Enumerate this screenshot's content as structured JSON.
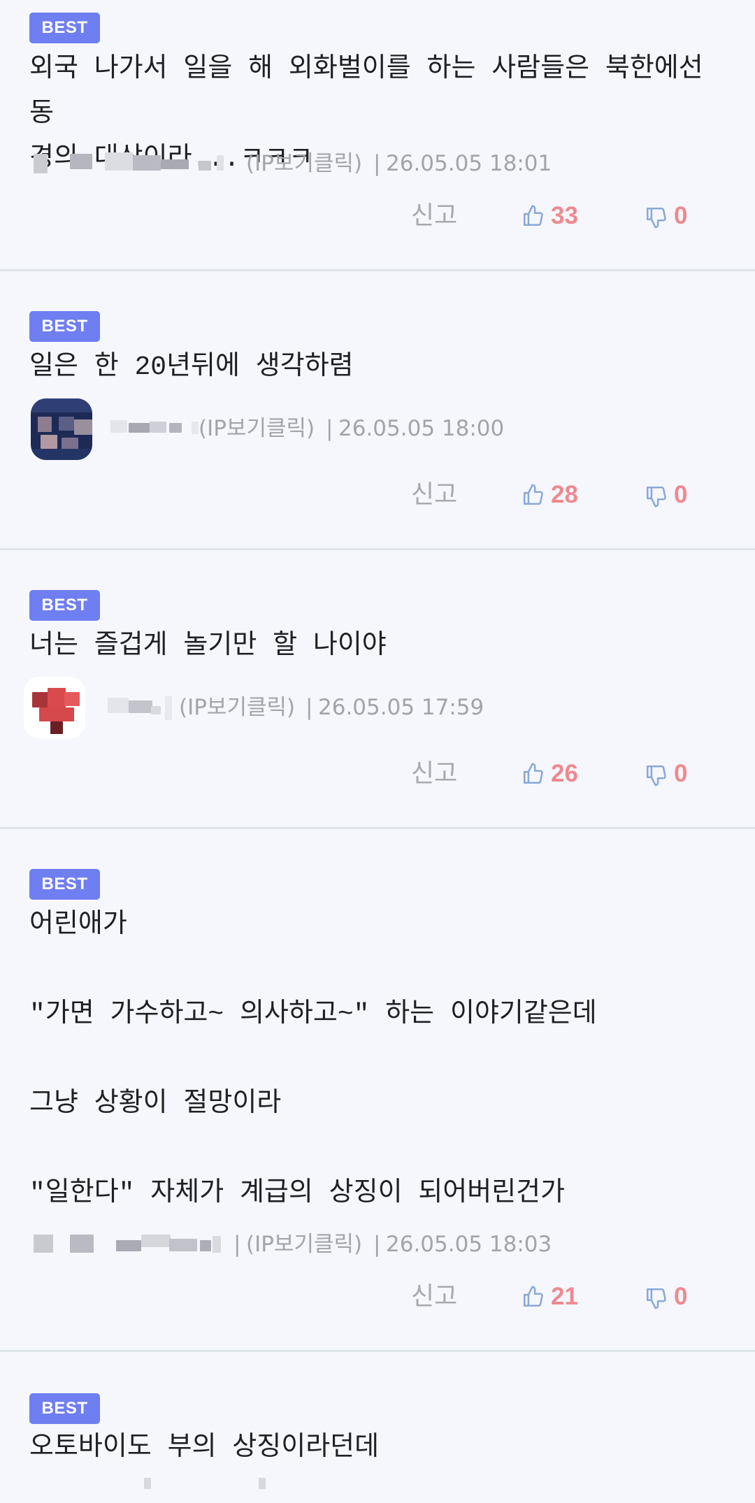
{
  "colors": {
    "background": "#f5f7fc",
    "badge": "#6f7ef0",
    "count": "#ee8a90",
    "icon": "#8aa8d8",
    "meta": "#a2a4ab"
  },
  "comments": [
    {
      "badge": "BEST",
      "text": "외국 나가서 일을 해 외화벌이를 하는 사람들은 북한에선 동\n경의 대상이라...ㅋㅋㅋ",
      "ip_label": "(IP보기클릭)",
      "separator": "|",
      "date": "26.05.05 18:01",
      "report_label": "신고",
      "likes": "33",
      "dislikes": "0",
      "like_icon": "thumbs-up-icon",
      "dislike_icon": "thumbs-down-icon"
    },
    {
      "badge": "BEST",
      "text": "일은 한 20년뒤에 생각하렴",
      "ip_label": "(IP보기클릭)",
      "separator": "|",
      "date": "26.05.05 18:00",
      "report_label": "신고",
      "likes": "28",
      "dislikes": "0",
      "like_icon": "thumbs-up-icon",
      "dislike_icon": "thumbs-down-icon"
    },
    {
      "badge": "BEST",
      "text": "너는 즐겁게 놀기만 할 나이야",
      "ip_label": "(IP보기클릭)",
      "separator": "|",
      "date": "26.05.05 17:59",
      "report_label": "신고",
      "likes": "26",
      "dislikes": "0",
      "like_icon": "thumbs-up-icon",
      "dislike_icon": "thumbs-down-icon"
    },
    {
      "badge": "BEST",
      "text": "어린애가\n\n\"가면 가수하고~ 의사하고~\" 하는 이야기같은데\n\n그냥 상황이 절망이라\n\n\"일한다\" 자체가 계급의 상징이 되어버린건가",
      "ip_label": "(IP보기클릭)",
      "separator": "|",
      "date": "26.05.05 18:03",
      "report_label": "신고",
      "likes": "21",
      "dislikes": "0",
      "like_icon": "thumbs-up-icon",
      "dislike_icon": "thumbs-down-icon"
    },
    {
      "badge": "BEST",
      "text": "오토바이도 부의 상징이라던데"
    }
  ]
}
